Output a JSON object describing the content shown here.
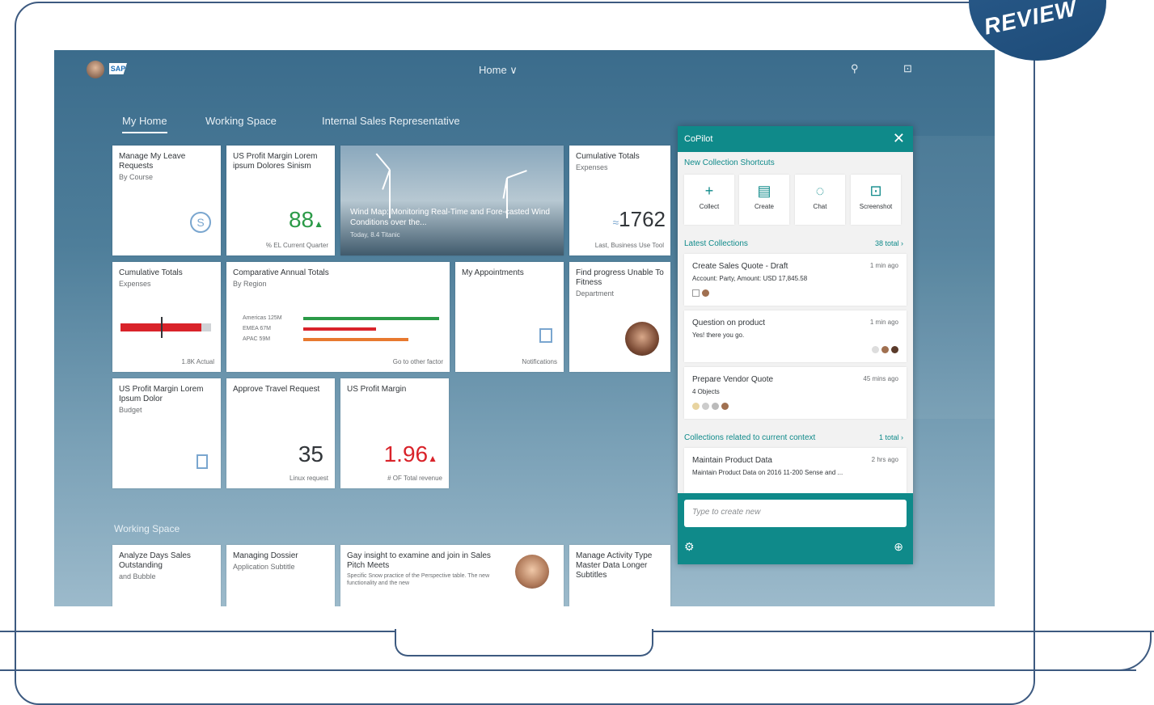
{
  "badge": "REVIEW",
  "shell": {
    "logo": "SAP",
    "title": "Home ∨",
    "search_icon": "⚲",
    "bell_icon": "⊡"
  },
  "tabs": [
    "My Home",
    "Working Space",
    "Internal Sales Representative"
  ],
  "tiles": {
    "t1": {
      "title": "Manage My Leave Requests",
      "sub": "By Course"
    },
    "t2": {
      "title": "US Profit Margin Lorem ipsum Dolores Sinism",
      "kpi": "88",
      "foot": "% EL Current Quarter"
    },
    "t3": {
      "title": "Wind Map: Monitoring Real-Time and Fore-casted Wind Conditions over the...",
      "sub": "Today, 8.4 Titanic"
    },
    "t4": {
      "title": "Cumulative Totals",
      "sub": "Expenses",
      "kpi": "1762",
      "foot": "Last, Business Use Tool"
    },
    "t5": {
      "title": "Cumulative Totals",
      "sub": "Expenses",
      "foot": "1.8K Actual"
    },
    "t6": {
      "title": "Comparative Annual Totals",
      "sub": "By Region",
      "rows": [
        "Americas 125M",
        "EMEA 67M",
        "APAC 59M"
      ],
      "foot": "Go to other factor"
    },
    "t7": {
      "title": "My Appointments",
      "foot": "Notifications"
    },
    "t8": {
      "title": "Find progress Unable To Fitness",
      "sub": "Department"
    },
    "t9": {
      "title": "US Profit Margin Lorem Ipsum Dolor",
      "sub": "Budget"
    },
    "t10": {
      "title": "Approve Travel Request",
      "kpi": "35",
      "foot": "Linux request"
    },
    "t11": {
      "title": "US Profit Margin",
      "kpi": "1.96",
      "foot": "# OF Total revenue"
    }
  },
  "working_space": {
    "title": "Working Space",
    "tiles": [
      {
        "title": "Analyze Days Sales Outstanding",
        "sub": "and Bubble"
      },
      {
        "title": "Managing Dossier",
        "sub": "Application Subtitle"
      },
      {
        "title": "Gay insight to examine and join in Sales Pitch Meets",
        "sub": "Specific Snow practice of the Perspective table. The new functionality and the new"
      },
      {
        "title": "Manage Activity Type Master Data Longer Subtitles",
        "sub": ""
      }
    ]
  },
  "copilot": {
    "title": "CoPilot",
    "close": "✕",
    "shortcuts_title": "New Collection Shortcuts",
    "shortcuts": [
      {
        "icon": "+",
        "label": "Collect"
      },
      {
        "icon": "▤",
        "label": "Create"
      },
      {
        "icon": "◌",
        "label": "Chat"
      },
      {
        "icon": "⊡",
        "label": "Screenshot"
      }
    ],
    "latest_title": "Latest Collections",
    "latest_more": "38 total ›",
    "cards": [
      {
        "title": "Create Sales Quote - Draft",
        "meta": "1 min ago",
        "desc": "Account: Party, Amount: USD 17,845.58"
      },
      {
        "title": "Question on product",
        "meta": "1 min ago",
        "desc": "Yes! there you go."
      },
      {
        "title": "Prepare Vendor Quote",
        "meta": "45 mins ago",
        "desc": "4 Objects"
      }
    ],
    "related_title": "Collections related to current context",
    "related_more": "1 total ›",
    "related_card": {
      "title": "Maintain Product Data",
      "meta": "2 hrs ago",
      "desc": "Maintain Product Data on 2016 11-200 Sense and ..."
    },
    "input_placeholder": "Type to create new",
    "gear": "⚙",
    "add": "⊕"
  }
}
